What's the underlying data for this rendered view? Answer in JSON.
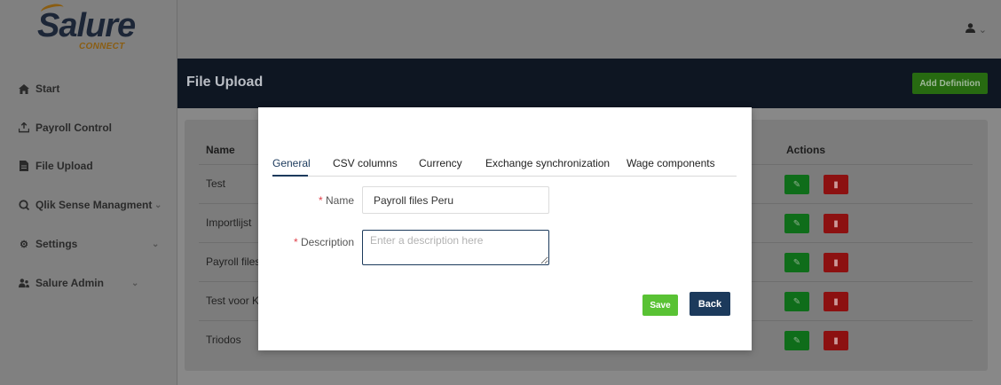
{
  "brand": {
    "name": "Salure",
    "sub": "CONNECT"
  },
  "sidebar": {
    "items": [
      {
        "label": "Start",
        "icon": "home-icon"
      },
      {
        "label": "Payroll Control",
        "icon": "upload-tray-icon"
      },
      {
        "label": "File Upload",
        "icon": "file-icon"
      },
      {
        "label": "Qlik Sense Managment",
        "icon": "search-circle-icon",
        "has_chevron": true
      },
      {
        "label": "Settings",
        "icon": "gear-icon",
        "has_chevron": true
      },
      {
        "label": "Salure Admin",
        "icon": "users-icon",
        "has_chevron": true
      }
    ]
  },
  "topbar": {
    "user_icon": "user-icon",
    "chevron": "chevron-down-icon"
  },
  "header": {
    "title": "File Upload",
    "add_button": "Add Definition"
  },
  "table": {
    "columns": [
      "Name",
      "Actions"
    ],
    "rows": [
      "Test",
      "Importlijst",
      "Payroll files",
      "Test voor KE",
      "Triodos"
    ]
  },
  "modal": {
    "tabs": [
      "General",
      "CSV columns",
      "Currency",
      "Exchange synchronization",
      "Wage components"
    ],
    "active_tab": "General",
    "name_label": "Name",
    "name_value": "Payroll files Peru",
    "description_label": "Description",
    "description_placeholder": "Enter a description here",
    "required_mark": "*",
    "save_label": "Save",
    "back_label": "Back"
  },
  "colors": {
    "accent_navy": "#1c3a5c",
    "save_green": "#59c234",
    "edit_green": "#2e8b1e",
    "delete_red": "#cc2b2b"
  }
}
